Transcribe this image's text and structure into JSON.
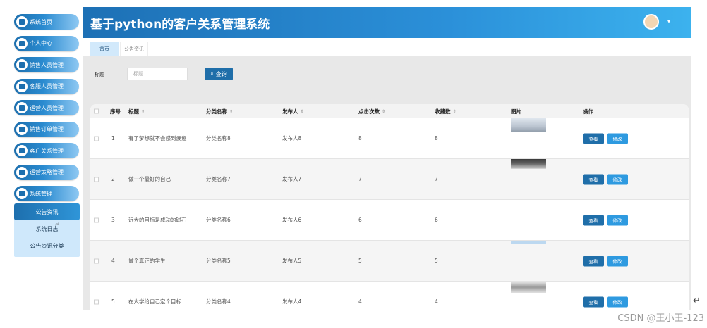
{
  "sidebar": {
    "items": [
      {
        "label": "系统首页",
        "icon": "home-icon"
      },
      {
        "label": "个人中心",
        "icon": "user-card-icon"
      },
      {
        "label": "销售人员管理",
        "icon": "book-icon"
      },
      {
        "label": "客服人员管理",
        "icon": "chat-icon"
      },
      {
        "label": "运营人员管理",
        "icon": "building-icon"
      },
      {
        "label": "销售订单管理",
        "icon": "badge-icon"
      },
      {
        "label": "客户关系管理",
        "icon": "people-icon"
      },
      {
        "label": "运营策略管理",
        "icon": "strategy-icon"
      },
      {
        "label": "系统管理",
        "icon": "gear-icon"
      }
    ],
    "submenu": [
      {
        "label": "公告资讯",
        "active": true
      },
      {
        "label": "系统日志",
        "active": false
      },
      {
        "label": "公告资讯分类",
        "active": false
      }
    ]
  },
  "header": {
    "title": "基于python的客户关系管理系统",
    "caret": "▾"
  },
  "tabs": [
    {
      "label": "首页",
      "active": true
    },
    {
      "label": "公告资讯",
      "active": false
    }
  ],
  "search": {
    "label": "标题",
    "placeholder": "标题",
    "button": "查询"
  },
  "table": {
    "headers": [
      "序号",
      "标题",
      "分类名称",
      "发布人",
      "点击次数",
      "收藏数",
      "图片",
      "操作"
    ],
    "rows": [
      {
        "no": "1",
        "title": "有了梦想就不会感到疲惫",
        "category": "分类名称8",
        "publisher": "发布人8",
        "clicks": "8",
        "favorites": "8"
      },
      {
        "no": "2",
        "title": "做一个最好的自己",
        "category": "分类名称7",
        "publisher": "发布人7",
        "clicks": "7",
        "favorites": "7"
      },
      {
        "no": "3",
        "title": "远大的目标是成功的磁石",
        "category": "分类名称6",
        "publisher": "发布人6",
        "clicks": "6",
        "favorites": "6"
      },
      {
        "no": "4",
        "title": "做个真正的学生",
        "category": "分类名称5",
        "publisher": "发布人5",
        "clicks": "5",
        "favorites": "5"
      },
      {
        "no": "5",
        "title": "在大学给自己定个目标",
        "category": "分类名称4",
        "publisher": "发布人4",
        "clicks": "4",
        "favorites": "4"
      }
    ],
    "actions": {
      "view": "查看",
      "edit": "修改"
    }
  },
  "corner_mark": "↵",
  "watermark": "CSDN @王小王-123",
  "colors": {
    "primary": "#1f6ea9",
    "accent": "#2e9ae0",
    "submenu_bg": "#cfe8fb"
  }
}
